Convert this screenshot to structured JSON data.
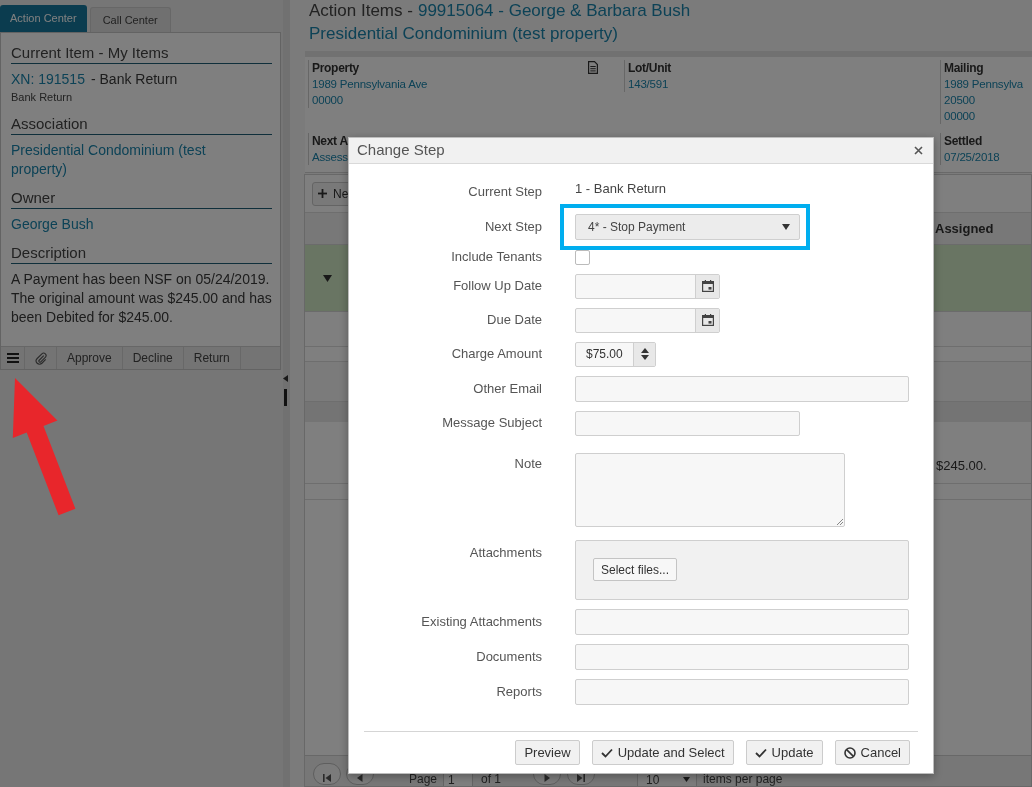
{
  "left_panel": {
    "tabs": [
      {
        "label": "Action Center",
        "selected": true
      },
      {
        "label": "Call Center",
        "selected": false
      }
    ],
    "sections": [
      {
        "heading": "Current Item - My Items",
        "lines": [
          [
            {
              "kind": "link",
              "text": "XN: 191515"
            },
            {
              "kind": "plain",
              "text": "- Bank Return"
            }
          ],
          [
            {
              "kind": "small",
              "text": "Bank Return"
            }
          ]
        ]
      },
      {
        "heading": "Association",
        "lines": [
          [
            {
              "kind": "link",
              "text": "Presidential Condominium (test property)"
            }
          ]
        ]
      },
      {
        "heading": "Owner",
        "lines": [
          [
            {
              "kind": "link",
              "text": "George Bush"
            }
          ]
        ]
      },
      {
        "heading": "Description",
        "lines": [
          [
            {
              "kind": "plain",
              "text": "A Payment has been NSF on 05/24/2019. The original amount was $245.00 and has been Debited for $245.00."
            }
          ]
        ]
      }
    ],
    "toolbar": {
      "buttons": [
        "Approve",
        "Decline",
        "Return"
      ]
    }
  },
  "page": {
    "title": {
      "prefix": "Action Items -",
      "account": "99915064 - George & Barbara Bush",
      "association": "Presidential Condominium (test property)"
    },
    "details": [
      [
        {
          "label": "Property",
          "lines": [
            "1989 Pennsylvania Ave",
            "00000"
          ],
          "document_icon": true
        },
        {
          "label": "Next A",
          "lines": [
            "Assess"
          ],
          "document_icon": false
        }
      ],
      [
        {
          "label": "Lot/Unit",
          "lines": [
            "143/591"
          ],
          "document_icon": false
        }
      ],
      [
        {
          "label": "Mailing",
          "lines": [
            "1989 Pennsylva",
            "20500",
            "00000"
          ],
          "document_icon": false
        },
        {
          "label": "Settled",
          "lines": [
            "07/25/2018"
          ],
          "document_icon": false
        }
      ]
    ],
    "grid": {
      "new_button": "Ne",
      "assigned_header": "Assigned",
      "rows": [
        {
          "selected": true,
          "expanded": true
        }
      ],
      "detail_text": "$245.00."
    },
    "pagination": {
      "page_label": "Page",
      "page": "1",
      "of_label": "of 1",
      "page_size": "10",
      "page_size_label": "items per page"
    }
  },
  "dialog": {
    "title": "Change Step",
    "fields": [
      {
        "kind": "static",
        "label": "Current Step",
        "value": "1 - Bank Return",
        "highlighted": false
      },
      {
        "kind": "select",
        "label": "Next Step",
        "value": "4* - Stop Payment",
        "highlighted": true
      },
      {
        "kind": "checkbox",
        "label": "Include Tenants",
        "checked": false,
        "highlighted": false
      },
      {
        "kind": "date",
        "label": "Follow Up Date",
        "highlighted": false
      },
      {
        "kind": "date",
        "label": "Due Date",
        "highlighted": false
      },
      {
        "kind": "currency",
        "label": "Charge Amount",
        "value": "$75.00",
        "highlighted": false
      },
      {
        "kind": "email",
        "label": "Other Email",
        "highlighted": false
      },
      {
        "kind": "line",
        "label": "Message Subject",
        "highlighted": false
      },
      {
        "kind": "textarea",
        "label": "Note",
        "highlighted": false
      },
      {
        "kind": "upload",
        "label": "Attachments",
        "button": "Select files...",
        "highlighted": false
      },
      {
        "kind": "list",
        "label": "Existing Attachments",
        "highlighted": false
      },
      {
        "kind": "list",
        "label": "Documents",
        "highlighted": false
      },
      {
        "kind": "list",
        "label": "Reports",
        "highlighted": false
      }
    ],
    "buttons": [
      {
        "kind": "plain",
        "label": "Preview"
      },
      {
        "kind": "confirm",
        "label": "Update and Select"
      },
      {
        "kind": "confirm",
        "label": "Update"
      },
      {
        "kind": "cancel",
        "label": "Cancel"
      }
    ]
  }
}
